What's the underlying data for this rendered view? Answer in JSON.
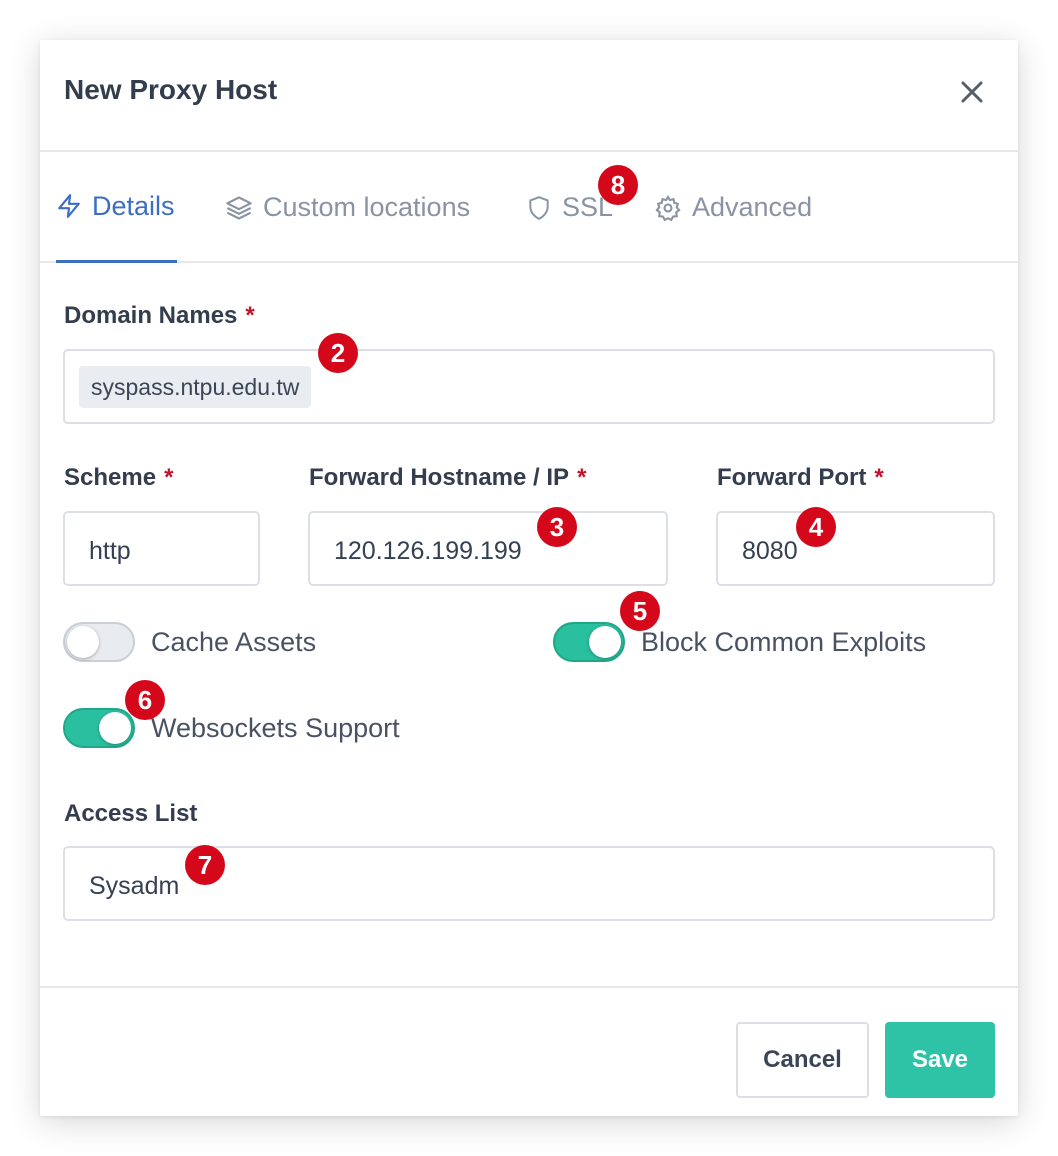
{
  "modal": {
    "title": "New Proxy Host"
  },
  "tabs": [
    {
      "label": "Details",
      "icon": "bolt-icon",
      "active": true
    },
    {
      "label": "Custom locations",
      "icon": "layers-icon",
      "active": false
    },
    {
      "label": "SSL",
      "icon": "shield-icon",
      "active": false
    },
    {
      "label": "Advanced",
      "icon": "gear-icon",
      "active": false
    }
  ],
  "form": {
    "domain_names": {
      "label": "Domain Names",
      "required_mark": "*",
      "chips": [
        "syspass.ntpu.edu.tw"
      ]
    },
    "scheme": {
      "label": "Scheme",
      "required_mark": "*",
      "value": "http"
    },
    "forward_host": {
      "label": "Forward Hostname / IP",
      "required_mark": "*",
      "value": "120.126.199.199"
    },
    "forward_port": {
      "label": "Forward Port",
      "required_mark": "*",
      "value": "8080"
    },
    "toggles": {
      "cache_assets": {
        "label": "Cache Assets",
        "on": false
      },
      "block_exploits": {
        "label": "Block Common Exploits",
        "on": true
      },
      "websockets": {
        "label": "Websockets Support",
        "on": true
      }
    },
    "access_list": {
      "label": "Access List",
      "value": "Sysadm"
    }
  },
  "annotations": [
    "2",
    "3",
    "4",
    "5",
    "6",
    "7",
    "8"
  ],
  "footer": {
    "cancel_label": "Cancel",
    "save_label": "Save"
  },
  "colors": {
    "accent_blue": "#3d6fc1",
    "toggle_on": "#29bf9f",
    "save_button": "#2ec3a7",
    "required": "#c4122d",
    "badge": "#d5081b"
  }
}
